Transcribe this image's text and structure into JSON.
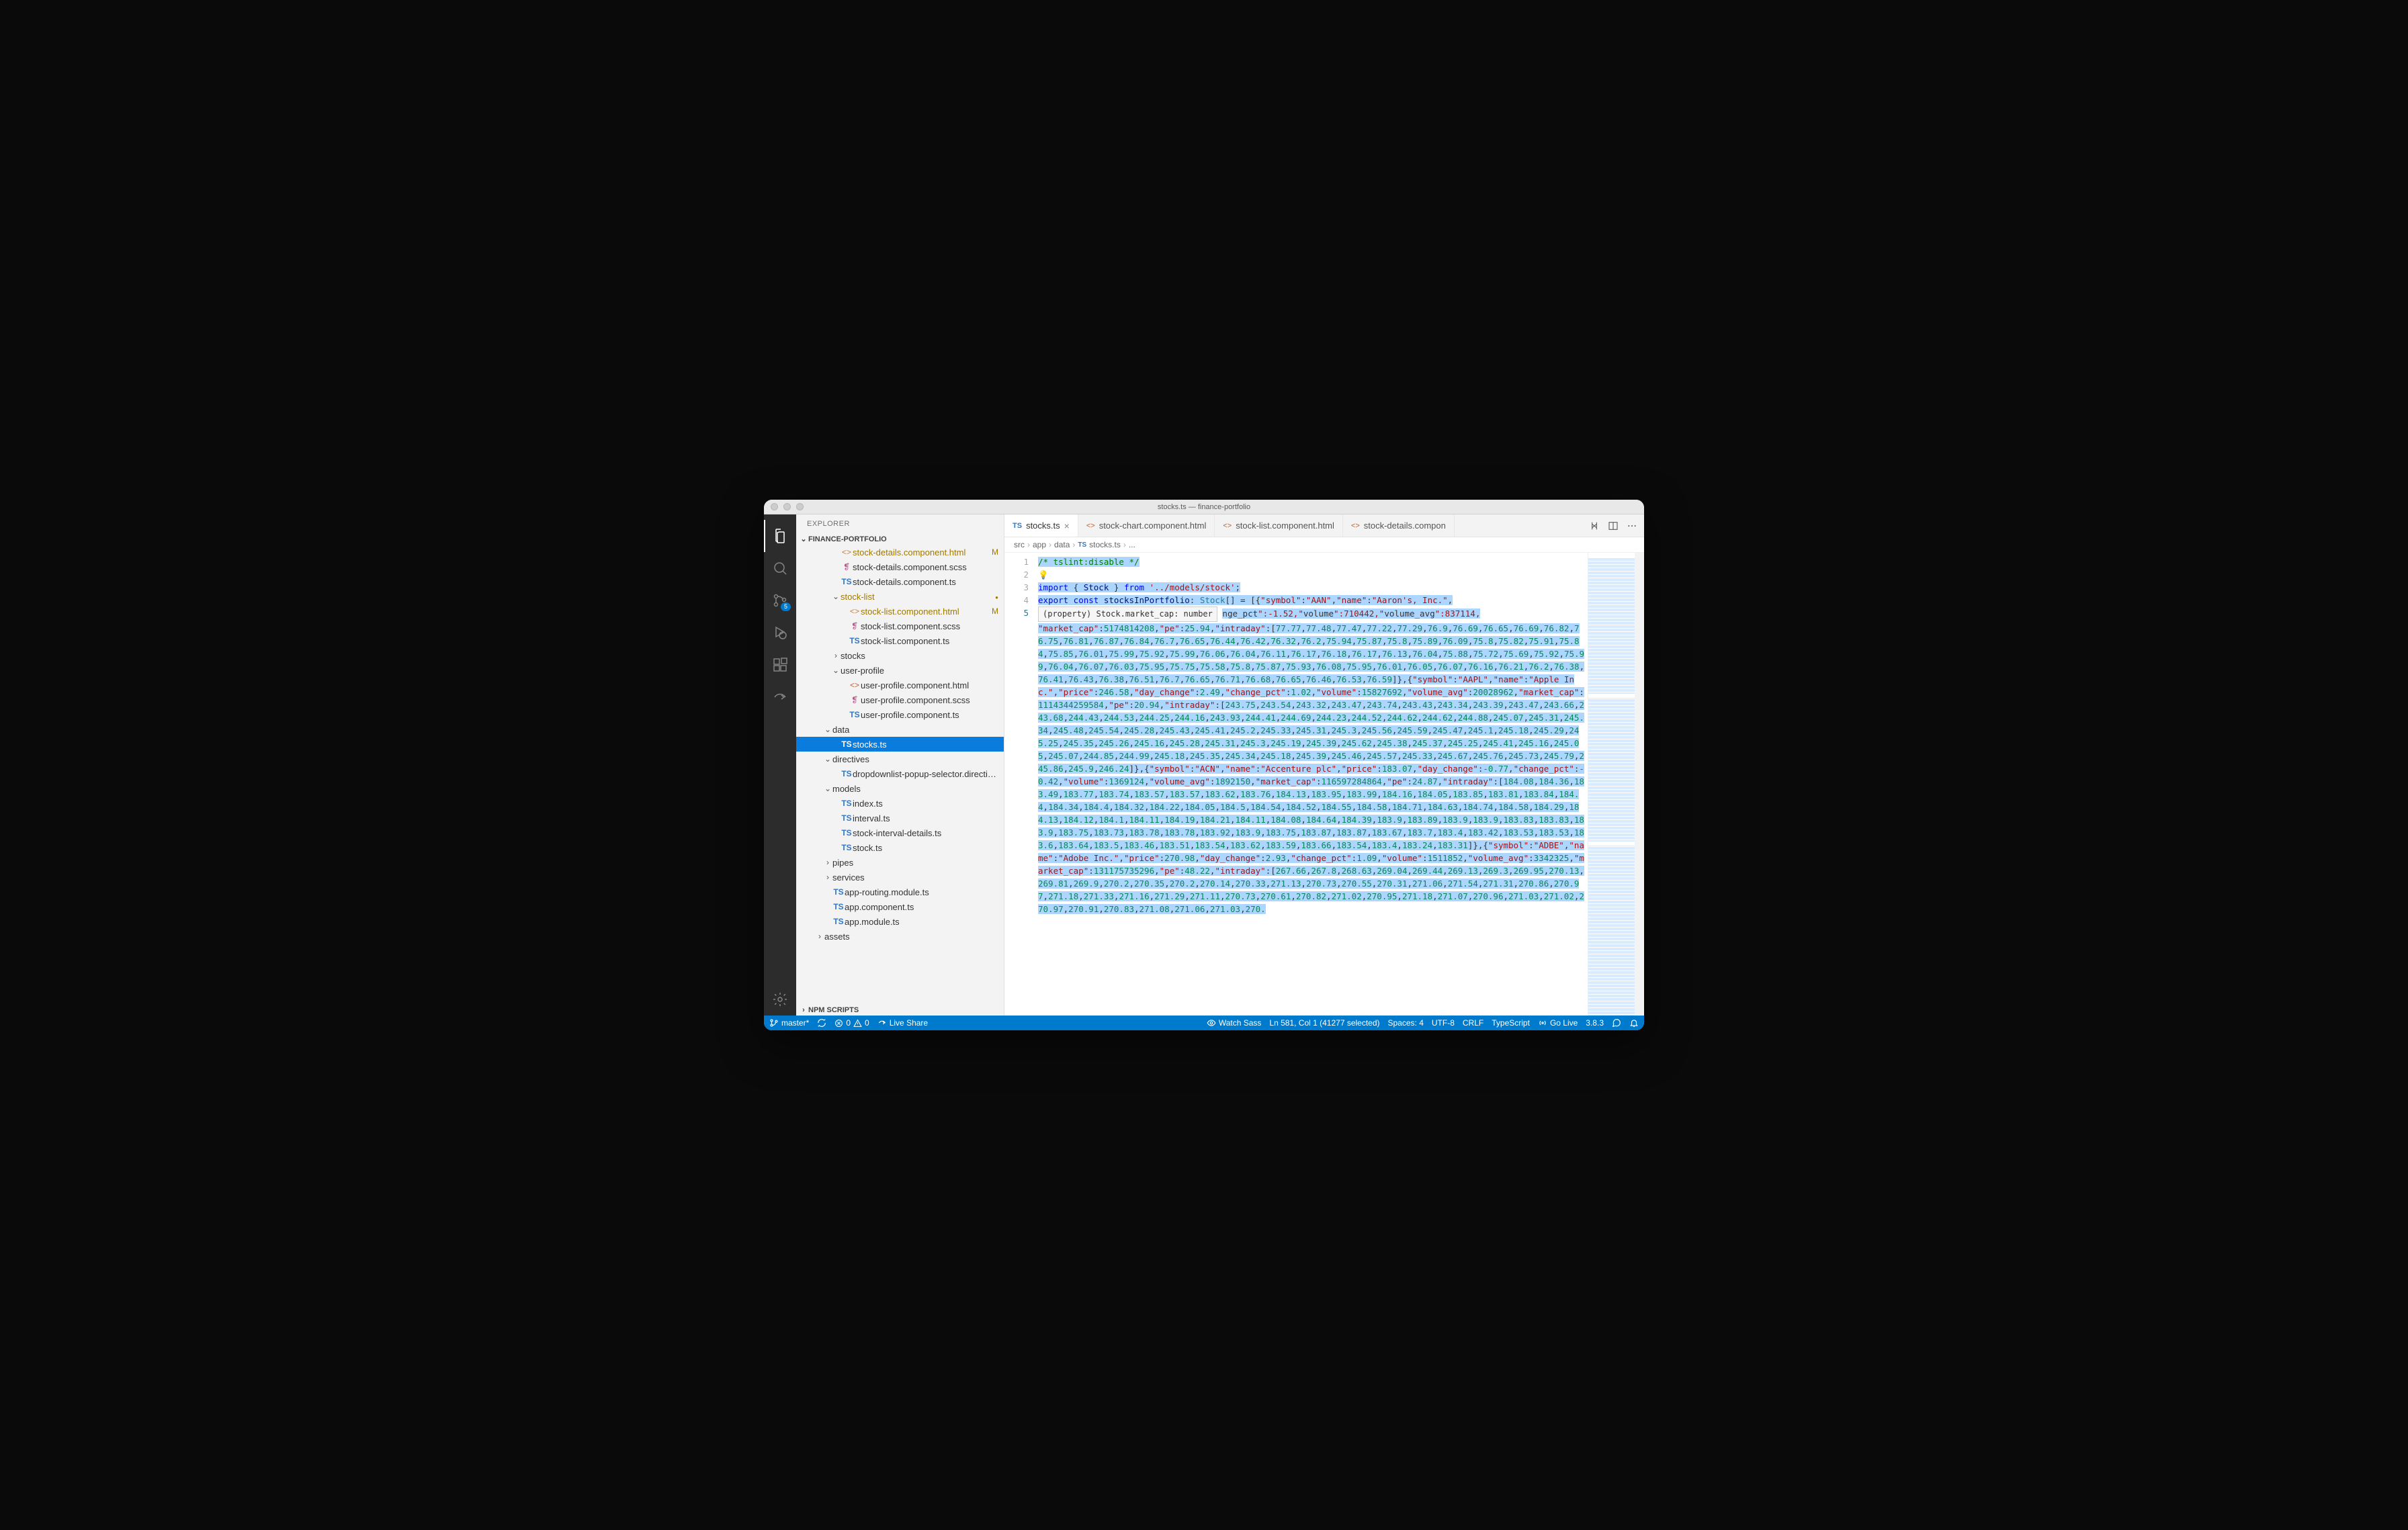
{
  "window": {
    "title": "stocks.ts — finance-portfolio"
  },
  "sidebar": {
    "title": "EXPLORER",
    "project": "FINANCE-PORTFOLIO",
    "npm_section": "NPM SCRIPTS"
  },
  "tree": [
    {
      "depth": 1,
      "kind": "file",
      "icon": "html",
      "label": "stock-details.component.html",
      "git": "M"
    },
    {
      "depth": 1,
      "kind": "file",
      "icon": "scss",
      "label": "stock-details.component.scss"
    },
    {
      "depth": 1,
      "kind": "file",
      "icon": "ts",
      "label": "stock-details.component.ts"
    },
    {
      "depth": 1,
      "kind": "folder-open",
      "label": "stock-list",
      "git": "dot"
    },
    {
      "depth": 2,
      "kind": "file",
      "icon": "html",
      "label": "stock-list.component.html",
      "git": "M"
    },
    {
      "depth": 2,
      "kind": "file",
      "icon": "scss",
      "label": "stock-list.component.scss"
    },
    {
      "depth": 2,
      "kind": "file",
      "icon": "ts",
      "label": "stock-list.component.ts"
    },
    {
      "depth": 1,
      "kind": "folder-closed",
      "label": "stocks"
    },
    {
      "depth": 1,
      "kind": "folder-open",
      "label": "user-profile"
    },
    {
      "depth": 2,
      "kind": "file",
      "icon": "html",
      "label": "user-profile.component.html"
    },
    {
      "depth": 2,
      "kind": "file",
      "icon": "scss",
      "label": "user-profile.component.scss"
    },
    {
      "depth": 2,
      "kind": "file",
      "icon": "ts",
      "label": "user-profile.component.ts"
    },
    {
      "depth": 0,
      "kind": "folder-open",
      "label": "data"
    },
    {
      "depth": 1,
      "kind": "file",
      "icon": "ts",
      "label": "stocks.ts",
      "selected": true
    },
    {
      "depth": 0,
      "kind": "folder-open",
      "label": "directives"
    },
    {
      "depth": 1,
      "kind": "file",
      "icon": "ts",
      "label": "dropdownlist-popup-selector.directive.ts"
    },
    {
      "depth": 0,
      "kind": "folder-open",
      "label": "models"
    },
    {
      "depth": 1,
      "kind": "file",
      "icon": "ts",
      "label": "index.ts"
    },
    {
      "depth": 1,
      "kind": "file",
      "icon": "ts",
      "label": "interval.ts"
    },
    {
      "depth": 1,
      "kind": "file",
      "icon": "ts",
      "label": "stock-interval-details.ts"
    },
    {
      "depth": 1,
      "kind": "file",
      "icon": "ts",
      "label": "stock.ts"
    },
    {
      "depth": 0,
      "kind": "folder-closed",
      "label": "pipes"
    },
    {
      "depth": 0,
      "kind": "folder-closed",
      "label": "services"
    },
    {
      "depth": 0,
      "kind": "file",
      "icon": "ts",
      "label": "app-routing.module.ts"
    },
    {
      "depth": 0,
      "kind": "file",
      "icon": "ts",
      "label": "app.component.ts"
    },
    {
      "depth": 0,
      "kind": "file",
      "icon": "ts",
      "label": "app.module.ts"
    },
    {
      "depth": -1,
      "kind": "folder-closed",
      "label": "assets"
    }
  ],
  "tabs": [
    {
      "icon": "ts",
      "label": "stocks.ts",
      "active": true,
      "close": true
    },
    {
      "icon": "html",
      "label": "stock-chart.component.html"
    },
    {
      "icon": "html",
      "label": "stock-list.component.html"
    },
    {
      "icon": "html",
      "label": "stock-details.compon"
    }
  ],
  "breadcrumbs": [
    "src",
    "app",
    "data",
    "stocks.ts",
    "..."
  ],
  "breadcrumb_file_icon": "ts",
  "editor": {
    "line_numbers": [
      "1",
      "2",
      "3",
      "4",
      "5"
    ],
    "line1": "/* tslint:disable */",
    "line3_import": "import",
    "line3_brace_open": " { ",
    "line3_stock": "Stock",
    "line3_brace_close": " } ",
    "line3_from": "from ",
    "line3_path": "'../models/stock'",
    "line3_semi": ";",
    "line5_export": "export",
    "line5_const": " const ",
    "line5_name": "stocksInPortfolio",
    "line5_colon_type": ": ",
    "line5_type": "Stock",
    "line5_brackets": "[] = [{",
    "line5_symbol_key": "\"symbol\"",
    "line5_symbol_val": "\"AAN\"",
    "line5_name_key": "\"name\"",
    "line5_name_val": "\"Aaron's, Inc.\"",
    "hint": "(property) Stock.market_cap: number",
    "tail_a": "nge_pct\":-1.52,\"volume\":710442,\"volume_avg\":837114,",
    "block1": "\"market_cap\":5174814208,\"pe\":25.94,\"intraday\":[77.77,77.48,77.47,77.22,77.29,76.9,76.69,76.65,76.69,76.82,76.75,76.81,76.87,76.84,76.7,76.65,76.44,76.42,76.32,76.2,75.94,75.87,75.8,75.89,76.09,75.8,75.82,75.91,75.84,75.85,76.01,75.99,75.92,75.99,76.06,76.04,76.11,76.17,76.18,76.17,76.13,76.04,75.88,75.72,75.69,75.92,75.99,76.04,76.07,76.03,75.95,75.75,75.58,75.8,75.87,75.93,76.08,75.95,76.01,76.05,76.07,76.16,76.21,76.2,76.38,76.41,76.43,76.38,76.51,76.7,76.65,76.71,76.68,76.65,76.46,76.53,76.59]},{\"symbol\":\"AAPL\",\"name\":\"Apple Inc.\",\"price\":246.58,\"day_change\":2.49,\"change_pct\":1.02,\"volume\":15827692,\"volume_avg\":20028962,\"market_cap\":1114344259584,\"pe\":20.94,\"intraday\":[243.75,243.54,243.32,243.47,243.74,243.43,243.34,243.39,243.47,243.66,243.68,244.43,244.53,244.25,244.16,243.93,244.41,244.69,244.23,244.52,244.62,244.62,244.88,245.07,245.31,245.34,245.48,245.54,245.28,245.43,245.41,245.2,245.33,245.31,245.3,245.56,245.59,245.47,245.1,245.18,245.29,245.25,245.35,245.26,245.16,245.28,245.31,245.3,245.19,245.39,245.62,245.38,245.37,245.25,245.41,245.16,245.05,245.07,244.85,244.99,245.18,245.35,245.34,245.18,245.39,245.46,245.57,245.33,245.67,245.76,245.73,245.79,245.86,245.9,246.24]},{\"symbol\":\"ACN\",\"name\":\"Accenture plc\",\"price\":183.07,\"day_change\":-0.77,\"change_pct\":-0.42,\"volume\":1369124,\"volume_avg\":1892150,\"market_cap\":116597284864,\"pe\":24.87,\"intraday\":[184.08,184.36,183.49,183.77,183.74,183.57,183.57,183.62,183.76,184.13,183.95,183.99,184.16,184.05,183.85,183.81,183.84,184.4,184.34,184.4,184.32,184.22,184.05,184.5,184.54,184.52,184.55,184.58,184.71,184.63,184.74,184.58,184.29,184.13,184.12,184.1,184.11,184.19,184.21,184.11,184.08,184.64,184.39,183.9,183.89,183.9,183.9,183.83,183.83,183.9,183.75,183.73,183.78,183.78,183.92,183.9,183.75,183.87,183.87,183.67,183.7,183.4,183.42,183.53,183.53,183.6,183.64,183.5,183.46,183.51,183.54,183.62,183.59,183.66,183.54,183.4,183.24,183.31]},{\"symbol\":\"ADBE\",\"name\":\"Adobe Inc.\",\"price\":270.98,\"day_change\":2.93,\"change_pct\":1.09,\"volume\":1511852,\"volume_avg\":3342325,\"market_cap\":131175735296,\"pe\":48.22,\"intraday\":[267.66,267.8,268.63,269.04,269.44,269.13,269.3,269.95,270.13,269.81,269.9,270.2,270.35,270.2,270.14,270.33,271.13,270.73,270.55,270.31,271.06,271.54,271.31,270.86,270.97,271.18,271.33,271.16,271.29,271.11,270.73,270.61,270.82,271.02,270.95,271.18,271.07,270.96,271.03,271.02,270.97,270.91,270.83,271.08,271.06,271.03,270."
  },
  "status": {
    "branch": "master*",
    "errors": "0",
    "warnings": "0",
    "live_share": "Live Share",
    "watch_sass": "Watch Sass",
    "position": "Ln 581, Col 1 (41277 selected)",
    "spaces": "Spaces: 4",
    "encoding": "UTF-8",
    "eol": "CRLF",
    "language": "TypeScript",
    "go_live": "Go Live",
    "version": "3.8.3"
  },
  "scm_badge": "5"
}
